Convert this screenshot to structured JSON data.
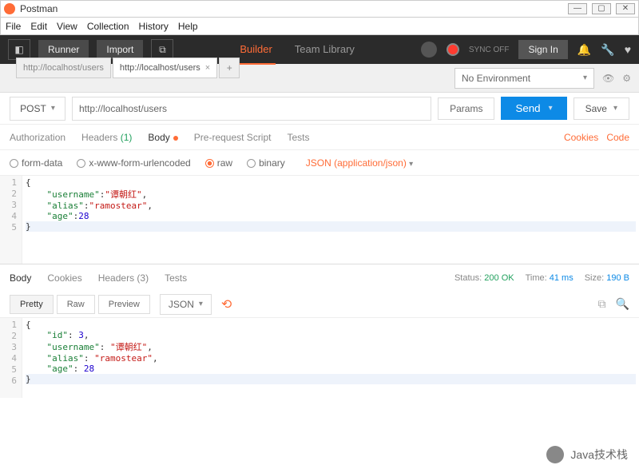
{
  "window": {
    "title": "Postman"
  },
  "menu": [
    "File",
    "Edit",
    "View",
    "Collection",
    "History",
    "Help"
  ],
  "toolbar": {
    "runner": "Runner",
    "import": "Import",
    "builder": "Builder",
    "team": "Team Library",
    "sync": "SYNC OFF",
    "signin": "Sign In"
  },
  "env": {
    "selected": "No Environment"
  },
  "tabs": {
    "inactive": "http://localhost/users",
    "active": "http://localhost/users"
  },
  "request": {
    "method": "POST",
    "url": "http://localhost/users",
    "params": "Params",
    "send": "Send",
    "save": "Save"
  },
  "reqTabs": {
    "auth": "Authorization",
    "headers": "Headers",
    "headersCount": "(1)",
    "body": "Body",
    "prereq": "Pre-request Script",
    "tests": "Tests",
    "cookies": "Cookies",
    "code": "Code"
  },
  "bodyOpts": {
    "formdata": "form-data",
    "xwww": "x-www-form-urlencoded",
    "raw": "raw",
    "binary": "binary",
    "ctype": "JSON (application/json)"
  },
  "reqBody": {
    "l1": "{",
    "l2_k": "\"username\"",
    "l2_v": "\"谭朝红\"",
    "l3_k": "\"alias\"",
    "l3_v": "\"ramostear\"",
    "l4_k": "\"age\"",
    "l4_v": "28",
    "l5": "}"
  },
  "respTabs": {
    "body": "Body",
    "cookies": "Cookies",
    "headers": "Headers",
    "headersCount": "(3)",
    "tests": "Tests"
  },
  "status": {
    "statusLbl": "Status:",
    "statusVal": "200 OK",
    "timeLbl": "Time:",
    "timeVal": "41 ms",
    "sizeLbl": "Size:",
    "sizeVal": "190 B"
  },
  "respOpts": {
    "pretty": "Pretty",
    "raw": "Raw",
    "preview": "Preview",
    "fmt": "JSON"
  },
  "respBody": {
    "l1": "{",
    "l2_k": "\"id\"",
    "l2_v": "3",
    "l3_k": "\"username\"",
    "l3_v": "\"谭朝红\"",
    "l4_k": "\"alias\"",
    "l4_v": "\"ramostear\"",
    "l5_k": "\"age\"",
    "l5_v": "28",
    "l6": "}"
  },
  "watermark": "Java技术栈"
}
